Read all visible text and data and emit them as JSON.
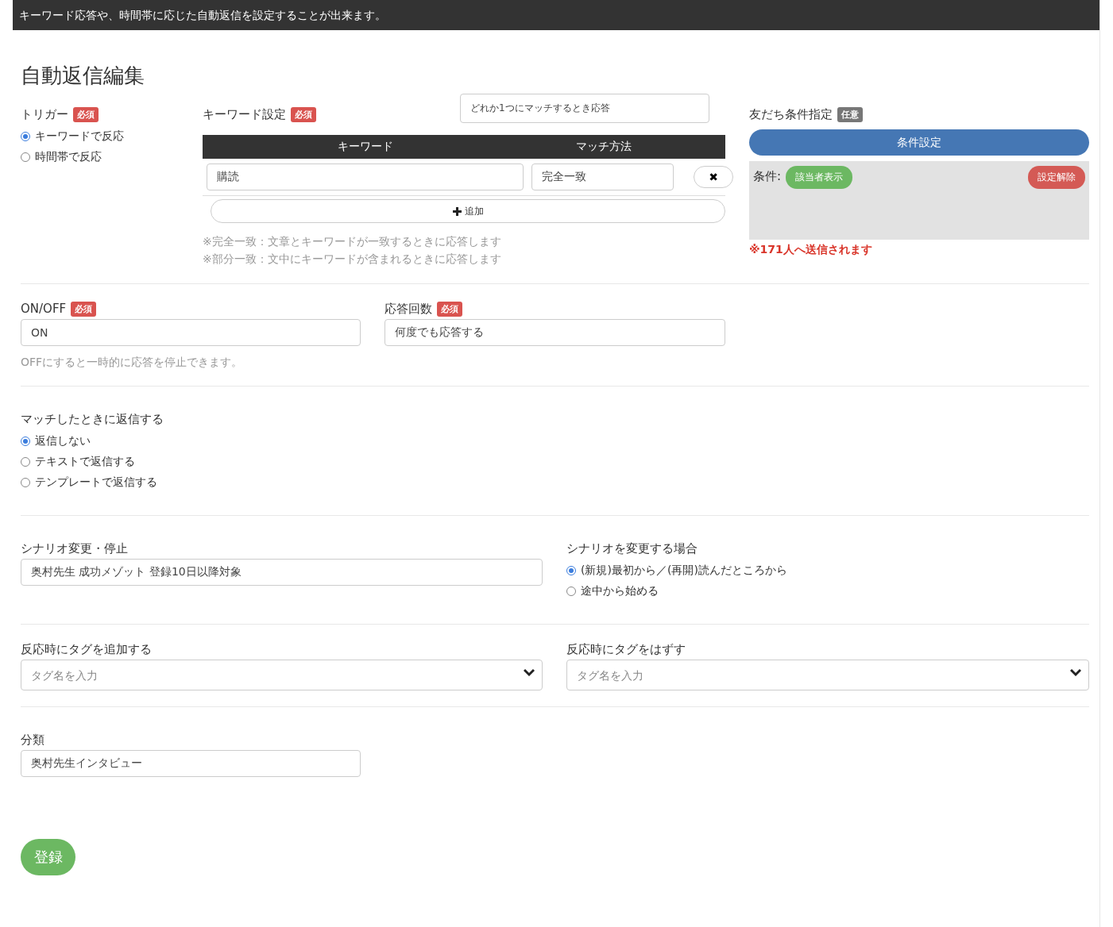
{
  "header": {
    "text": "キーワード応答や、時間帯に応じた自動返信を設定することが出来ます。"
  },
  "title": "自動返信編集",
  "trigger": {
    "label": "トリガー",
    "badge": {
      "text": "必須",
      "kind": "required"
    },
    "options": [
      {
        "label": "キーワードで反応",
        "selected": true
      },
      {
        "label": "時間帯で反応",
        "selected": false
      }
    ]
  },
  "keyword_settings": {
    "label": "キーワード設定",
    "badge": {
      "text": "必須",
      "kind": "required"
    },
    "match_mode": "どれか1つにマッチするとき応答",
    "columns": [
      "キーワード",
      "マッチ方法"
    ],
    "rows": [
      {
        "keyword": "購読",
        "match": "完全一致",
        "remove": "✖"
      }
    ],
    "add_button": "追加",
    "notes": [
      "※完全一致：文章とキーワードが一致するときに応答します",
      "※部分一致：文中にキーワードが含まれるときに応答します"
    ]
  },
  "friend_conditions": {
    "label": "友だち条件指定",
    "badge": {
      "text": "任意",
      "kind": "optional"
    },
    "set_button": "条件設定",
    "condition_label": "条件:",
    "show_button": "該当者表示",
    "clear_button": "設定解除",
    "recipients": "※171人へ送信されます"
  },
  "on_off": {
    "label": "ON/OFF",
    "badge": {
      "text": "必須",
      "kind": "required"
    },
    "value": "ON",
    "hint": "OFFにすると一時的に応答を停止できます。"
  },
  "response_count": {
    "label": "応答回数",
    "badge": {
      "text": "必須",
      "kind": "required"
    },
    "value": "何度でも応答する"
  },
  "reply_on_match": {
    "label": "マッチしたときに返信する",
    "options": [
      {
        "label": "返信しない",
        "selected": true
      },
      {
        "label": "テキストで返信する",
        "selected": false
      },
      {
        "label": "テンプレートで返信する",
        "selected": false
      }
    ]
  },
  "scenario": {
    "label": "シナリオ変更・停止",
    "value": "奥村先生 成功メゾット 登録10日以降対象"
  },
  "scenario_mode": {
    "label": "シナリオを変更する場合",
    "options": [
      {
        "label": "(新規)最初から／(再開)読んだところから",
        "selected": true
      },
      {
        "label": "途中から始める",
        "selected": false
      }
    ]
  },
  "add_tags": {
    "label": "反応時にタグを追加する",
    "placeholder": "タグ名を入力"
  },
  "remove_tags": {
    "label": "反応時にタグをはずす",
    "placeholder": "タグ名を入力"
  },
  "category": {
    "label": "分類",
    "value": "奥村先生インタビュー"
  },
  "submit": "登録"
}
